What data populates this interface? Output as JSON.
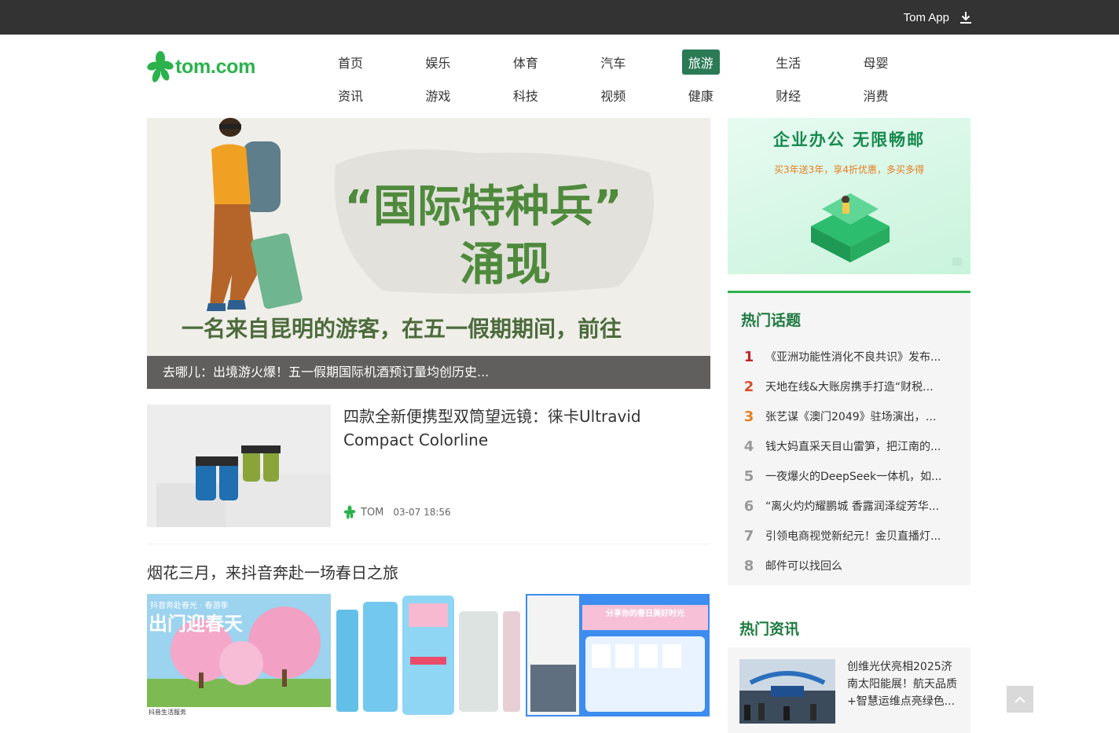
{
  "topbar": {
    "app_label": "Tom App",
    "icon": "download-icon"
  },
  "logo": {
    "text": "tom.com"
  },
  "nav": {
    "row1": [
      {
        "label": "首页"
      },
      {
        "label": "娱乐"
      },
      {
        "label": "体育"
      },
      {
        "label": "汽车"
      },
      {
        "label": "旅游",
        "active": true
      },
      {
        "label": "生活"
      },
      {
        "label": "母婴"
      }
    ],
    "row2": [
      {
        "label": "资讯"
      },
      {
        "label": "游戏"
      },
      {
        "label": "科技"
      },
      {
        "label": "视频"
      },
      {
        "label": "健康"
      },
      {
        "label": "财经"
      },
      {
        "label": "消费"
      }
    ]
  },
  "hero": {
    "image_text_quote": "“国际特种兵”",
    "image_text_title": "涌现",
    "image_text_sub": "一名来自昆明的游客，在五一假期期间，前往",
    "caption": "去哪儿：出境游火爆！五一假期国际机酒预订量均创历史..."
  },
  "article": {
    "title": "四款全新便携型双筒望远镜：徕卡Ultravid Compact Colorline",
    "source": "TOM",
    "time": "03-07 18:56"
  },
  "section": {
    "title": "烟花三月，来抖音奔赴一场春日之旅",
    "img1_tag": "抖音奔赴春光 · 春游季",
    "img1_headline": "出门迎春天",
    "img1_footer": "抖音生活服务",
    "img3_headline": "分享你的春日美好时光"
  },
  "ad": {
    "headline": "企业办公 无限畅邮",
    "sub": "买3年送3年，享4折优惠，多买多得"
  },
  "hot_topics": {
    "title": "热门话题",
    "items": [
      {
        "rank": "1",
        "text": "《亚洲功能性消化不良共识》发布..."
      },
      {
        "rank": "2",
        "text": "天地在线&大账房携手打造“财税..."
      },
      {
        "rank": "3",
        "text": "张艺谋《澳门2049》驻场演出，掀..."
      },
      {
        "rank": "4",
        "text": "钱大妈直采天目山雷笋，把江南的..."
      },
      {
        "rank": "5",
        "text": "一夜爆火的DeepSeek一体机，如..."
      },
      {
        "rank": "6",
        "text": "“离火灼灼耀鹏城 香露润泽绽芳华..."
      },
      {
        "rank": "7",
        "text": "引领电商视觉新纪元！金贝直播灯..."
      },
      {
        "rank": "8",
        "text": "邮件可以找回么"
      }
    ]
  },
  "hot_news": {
    "title": "热门资讯",
    "item": "创维光伏亮相2025济南太阳能展！航天品质+智慧运维点亮绿色..."
  },
  "colors": {
    "brand": "#2bb24c",
    "nav_active": "#2a7a55",
    "topbar": "#333333"
  }
}
